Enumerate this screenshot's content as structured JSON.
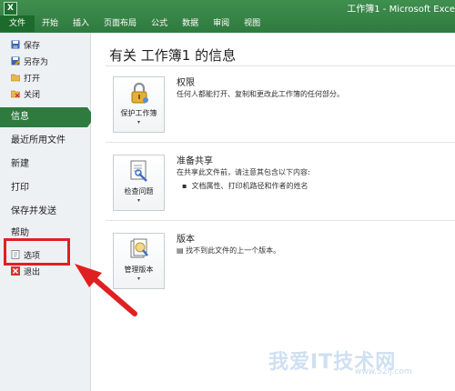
{
  "window": {
    "title": "工作簿1 - Microsoft Exce"
  },
  "ribbon": {
    "tabs": [
      {
        "label": "文件"
      },
      {
        "label": "开始"
      },
      {
        "label": "插入"
      },
      {
        "label": "页面布局"
      },
      {
        "label": "公式"
      },
      {
        "label": "数据"
      },
      {
        "label": "审阅"
      },
      {
        "label": "视图"
      }
    ]
  },
  "backstage": {
    "quick": [
      {
        "label": "保存",
        "icon": "save-icon"
      },
      {
        "label": "另存为",
        "icon": "save-as-icon"
      },
      {
        "label": "打开",
        "icon": "open-folder-icon"
      },
      {
        "label": "关闭",
        "icon": "close-file-icon"
      }
    ],
    "nav": [
      {
        "label": "信息"
      },
      {
        "label": "最近所用文件"
      },
      {
        "label": "新建"
      },
      {
        "label": "打印"
      },
      {
        "label": "保存并发送"
      },
      {
        "label": "帮助"
      }
    ],
    "bottom": [
      {
        "label": "选项",
        "icon": "options-icon"
      },
      {
        "label": "退出",
        "icon": "exit-icon"
      }
    ]
  },
  "info": {
    "title": "有关 工作簿1 的信息",
    "sections": [
      {
        "button": "保护工作簿",
        "title": "权限",
        "desc": "任何人都能打开、复制和更改此工作簿的任何部分。"
      },
      {
        "button": "检查问题",
        "title": "准备共享",
        "desc": "在共享此文件前，请注意其包含以下内容:",
        "bullet": "文档属性、打印机路径和作者的姓名"
      },
      {
        "button": "管理版本",
        "title": "版本",
        "desc": "找不到此文件的上一个版本。"
      }
    ]
  },
  "watermark": {
    "main": "我爱IT技术网",
    "sub": "www.52ij.com"
  },
  "colors": {
    "ribbon": "#2f7a3f",
    "file_tab": "#1d6b2c",
    "highlight": "#e02020"
  }
}
